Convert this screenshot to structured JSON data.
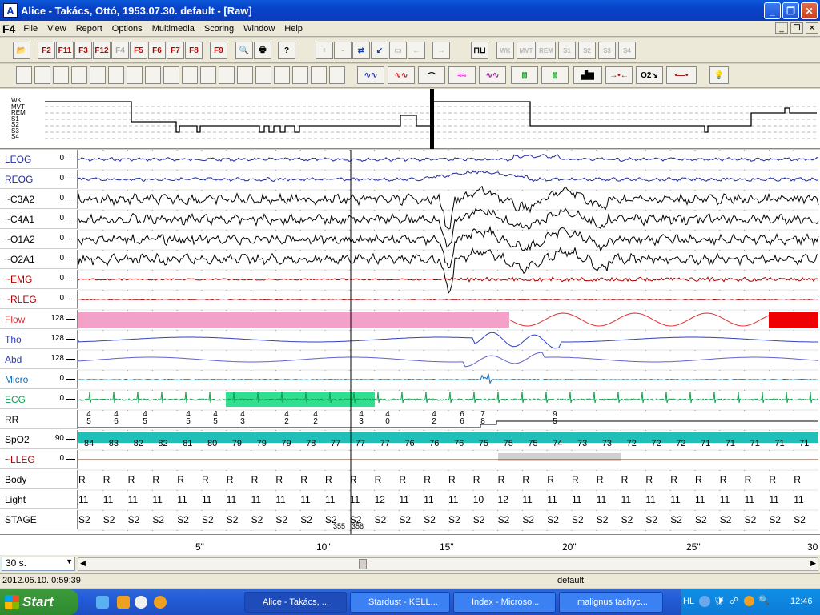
{
  "window": {
    "title": "Alice - Takács, Ottó, 1953.07.30. default - [Raw]",
    "app_icon_letter": "A"
  },
  "menu": {
    "shortcut": "F4",
    "items": [
      "File",
      "View",
      "Report",
      "Options",
      "Multimedia",
      "Scoring",
      "Window",
      "Help"
    ]
  },
  "toolbar1": {
    "fkeys": [
      "F2",
      "F11",
      "F3",
      "F12",
      "F4",
      "F5",
      "F6",
      "F7",
      "F8",
      "F9"
    ],
    "stage_buttons": [
      "WK",
      "MVT",
      "REM",
      "S1",
      "S2",
      "S3",
      "S4"
    ],
    "nav_symbols": [
      "+",
      "-",
      "⇄",
      "↙",
      "▭",
      "←",
      "→"
    ]
  },
  "toolbar2": {
    "o2_label": "O2↘"
  },
  "hypnogram": {
    "labels": [
      "WK",
      "MVT",
      "REM",
      "S1",
      "S2",
      "S3",
      "S4"
    ]
  },
  "channels": [
    {
      "name": "LEOG",
      "scale": "0",
      "color": "#1f2a9a"
    },
    {
      "name": "REOG",
      "scale": "0",
      "color": "#1f2a9a"
    },
    {
      "name": "~C3A2",
      "scale": "0",
      "color": "#000000"
    },
    {
      "name": "~C4A1",
      "scale": "0",
      "color": "#000000"
    },
    {
      "name": "~O1A2",
      "scale": "0",
      "color": "#000000"
    },
    {
      "name": "~O2A1",
      "scale": "0",
      "color": "#000000"
    },
    {
      "name": "~EMG",
      "scale": "0",
      "color": "#b00000"
    },
    {
      "name": "~RLEG",
      "scale": "0",
      "color": "#b00000"
    },
    {
      "name": "Flow",
      "scale": "128",
      "color": "#e03030"
    },
    {
      "name": "Tho",
      "scale": "128",
      "color": "#3040c0"
    },
    {
      "name": "Abd",
      "scale": "128",
      "color": "#3040c0"
    },
    {
      "name": "Micro",
      "scale": "0",
      "color": "#1070c0"
    },
    {
      "name": "ECG",
      "scale": "0",
      "color": "#10a050"
    },
    {
      "name": "RR",
      "scale": "",
      "color": "#000000"
    },
    {
      "name": "SpO2",
      "scale": "90",
      "color": "#000000"
    },
    {
      "name": "~LLEG",
      "scale": "0",
      "color": "#b00000"
    },
    {
      "name": "Body",
      "scale": "",
      "color": "#000000"
    },
    {
      "name": "Light",
      "scale": "",
      "color": "#000000"
    },
    {
      "name": "STAGE",
      "scale": "",
      "color": "#000000"
    }
  ],
  "rr_values": [
    [
      "4",
      "5"
    ],
    [
      "4",
      "6"
    ],
    [
      "4",
      "5"
    ],
    [
      "4",
      "5"
    ],
    [
      "4",
      "5"
    ],
    [
      "4",
      "3"
    ],
    [
      "4",
      "2"
    ],
    [
      "4",
      "2"
    ],
    [
      "4",
      "3"
    ],
    [
      "4",
      "0"
    ],
    [
      "4",
      "2"
    ],
    [
      "6",
      "6"
    ],
    [
      "7",
      "8"
    ],
    [
      "9",
      "5"
    ]
  ],
  "spo2_values": [
    "84",
    "83",
    "82",
    "82",
    "81",
    "80",
    "79",
    "79",
    "79",
    "78",
    "77",
    "77",
    "77",
    "76",
    "76",
    "76",
    "75",
    "75",
    "75",
    "74",
    "73",
    "73",
    "72",
    "72",
    "72",
    "71",
    "71",
    "71",
    "71",
    "71"
  ],
  "body_values": [
    "R",
    "R",
    "R",
    "R",
    "R",
    "R",
    "R",
    "R",
    "R",
    "R",
    "R",
    "R",
    "R",
    "R",
    "R",
    "R",
    "R",
    "R",
    "R",
    "R",
    "R",
    "R",
    "R",
    "R",
    "R",
    "R",
    "R",
    "R",
    "R",
    "R"
  ],
  "light_values": [
    "11",
    "11",
    "11",
    "11",
    "11",
    "11",
    "11",
    "11",
    "11",
    "11",
    "11",
    "11",
    "12",
    "11",
    "11",
    "11",
    "10",
    "12",
    "11",
    "11",
    "11",
    "11",
    "11",
    "11",
    "11",
    "11",
    "11",
    "11",
    "11",
    "11"
  ],
  "stage_values": [
    "S2",
    "S2",
    "S2",
    "S2",
    "S2",
    "S2",
    "S2",
    "S2",
    "S2",
    "S2",
    "S2",
    "S2",
    "S2",
    "S2",
    "S2",
    "S2",
    "S2",
    "S2",
    "S2",
    "S2",
    "S2",
    "S2",
    "S2",
    "S2",
    "S2",
    "S2",
    "S2",
    "S2",
    "S2",
    "S2"
  ],
  "epoch_marker": {
    "left": "355",
    "right": "356"
  },
  "time_axis": [
    "5\"",
    "10\"",
    "15\"",
    "20\"",
    "25\"",
    "30"
  ],
  "epoch_length": "30 s.",
  "status": {
    "datetime": "2012.05.10. 0:59:39",
    "profile": "default"
  },
  "taskbar": {
    "start": "Start",
    "tasks": [
      "Alice - Takács, ...",
      "Stardust - KELL...",
      "Index - Microso...",
      "malignus tachyc..."
    ],
    "tray_lang": "HL",
    "clock": "12:46"
  }
}
